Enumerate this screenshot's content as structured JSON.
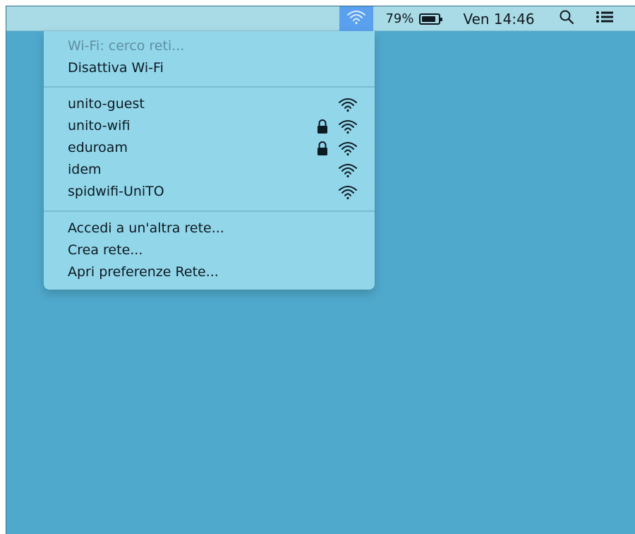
{
  "menubar": {
    "battery_percent": "79%",
    "battery_level": 0.79,
    "clock": "Ven 14:46",
    "icons": [
      "wifi-icon",
      "battery-icon",
      "search-icon",
      "notification-list-icon"
    ],
    "wifi_active_color": "#5aa0ef"
  },
  "wifi_menu": {
    "status": "Wi-Fi: cerco reti...",
    "toggle": "Disattiva Wi-Fi",
    "networks": [
      {
        "name": "unito-guest",
        "locked": false
      },
      {
        "name": "unito-wifi",
        "locked": true
      },
      {
        "name": "eduroam",
        "locked": true
      },
      {
        "name": "idem",
        "locked": false
      },
      {
        "name": "spidwifi-UniTO",
        "locked": false
      }
    ],
    "actions": [
      "Accedi a un'altra rete...",
      "Crea rete...",
      "Apri preferenze Rete..."
    ]
  },
  "colors": {
    "desktop": "#4fa9cc",
    "menubar": "#a9dbe6",
    "menu": "#92d6e9"
  }
}
